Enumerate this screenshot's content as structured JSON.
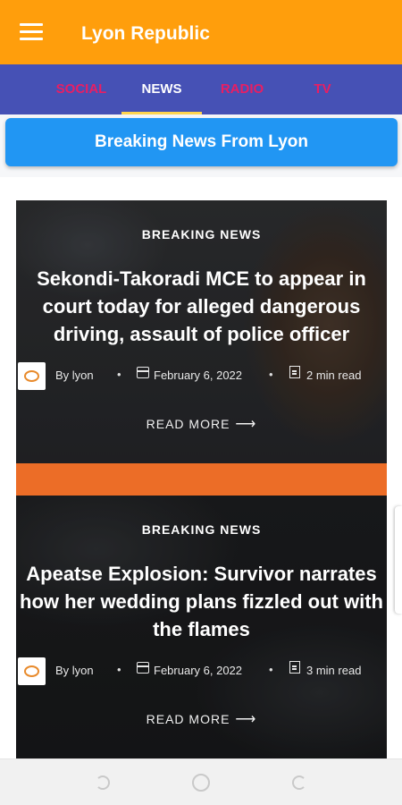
{
  "colors": {
    "appbar": "#ff9e0c",
    "tabbar": "#4651b5",
    "tab_active": "#ffffff",
    "tab_inactive": "#e91e63",
    "indicator": "#ffd54f",
    "banner": "#2196f3",
    "accent_strip": "#ec6d27"
  },
  "appbar": {
    "title": "Lyon Republic",
    "menu_icon": "hamburger-menu-icon"
  },
  "tabs": [
    {
      "label": "SOCIAL",
      "active": false
    },
    {
      "label": "NEWS",
      "active": true
    },
    {
      "label": "RADIO",
      "active": false
    },
    {
      "label": "TV",
      "active": false
    }
  ],
  "banner": {
    "text": "Breaking News From Lyon"
  },
  "articles": [
    {
      "category": "BREAKING NEWS",
      "title": "Sekondi-Takoradi MCE to appear in court today for alleged dangerous driving, assault of police officer",
      "author": "By  lyon",
      "date": "February 6, 2022",
      "read_time": "2 min read",
      "read_more": "READ MORE"
    },
    {
      "category": "BREAKING NEWS",
      "title": "Apeatse Explosion: Survivor narrates how her wedding plans fizzled out with the flames",
      "author": "By  lyon",
      "date": "February 6, 2022",
      "read_time": "3 min read",
      "read_more": "READ MORE"
    }
  ],
  "system_nav": [
    "back-icon",
    "home-icon",
    "recents-icon"
  ]
}
